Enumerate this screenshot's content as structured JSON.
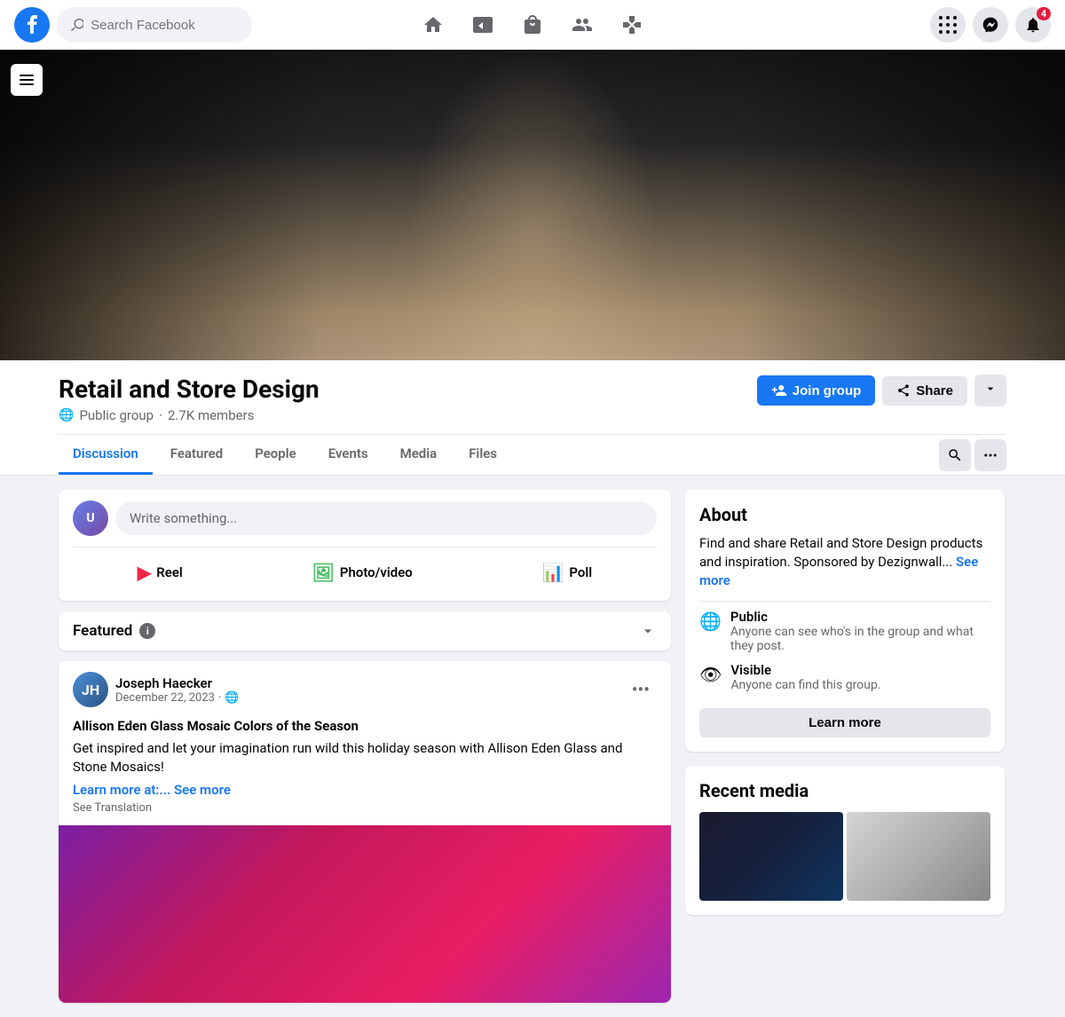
{
  "header": {
    "search_placeholder": "Search Facebook",
    "logo_alt": "Facebook"
  },
  "nav": {
    "items": [
      {
        "id": "home",
        "label": "Home",
        "active": false
      },
      {
        "id": "video",
        "label": "Watch",
        "active": false
      },
      {
        "id": "marketplace",
        "label": "Marketplace",
        "active": false
      },
      {
        "id": "groups",
        "label": "Groups",
        "active": false
      },
      {
        "id": "gaming",
        "label": "Gaming",
        "active": false
      }
    ]
  },
  "header_right": {
    "grid_label": "Menu",
    "messenger_label": "Messenger",
    "notifications_label": "Notifications",
    "notification_badge": "4"
  },
  "group": {
    "name": "Retail and Store Design",
    "type": "Public group",
    "members": "2.7K members",
    "join_label": "Join group",
    "share_label": "Share",
    "more_label": "More options"
  },
  "tabs": [
    {
      "id": "discussion",
      "label": "Discussion",
      "active": true
    },
    {
      "id": "featured",
      "label": "Featured",
      "active": false
    },
    {
      "id": "people",
      "label": "People",
      "active": false
    },
    {
      "id": "events",
      "label": "Events",
      "active": false
    },
    {
      "id": "media",
      "label": "Media",
      "active": false
    },
    {
      "id": "files",
      "label": "Files",
      "active": false
    }
  ],
  "post_box": {
    "placeholder": "Write something...",
    "reel_label": "Reel",
    "photo_video_label": "Photo/video",
    "poll_label": "Poll"
  },
  "featured_section": {
    "title": "Featured",
    "info_tooltip": "i"
  },
  "post": {
    "author_name": "Joseph Haecker",
    "author_initials": "JH",
    "date": "December 22, 2023",
    "visibility": "Public",
    "title": "Allison Eden Glass Mosaic Colors of the Season",
    "text": "Get inspired and let your imagination run wild this holiday season with Allison Eden Glass and Stone Mosaics!",
    "link_text": "Learn more at:...",
    "see_more_label": "See more",
    "translation_label": "See Translation"
  },
  "about": {
    "title": "About",
    "description": "Find and share Retail and Store Design products and inspiration. Sponsored by Dezignwall...",
    "see_more_label": "See more",
    "public_label": "Public",
    "public_sub": "Anyone can see who's in the group and what they post.",
    "visible_label": "Visible",
    "visible_sub": "Anyone can find this group.",
    "learn_more_label": "Learn more"
  },
  "recent_media": {
    "title": "Recent media"
  },
  "colors": {
    "primary": "#1877f2",
    "bg": "#f0f2f5",
    "white": "#ffffff",
    "text_secondary": "#65676b"
  }
}
